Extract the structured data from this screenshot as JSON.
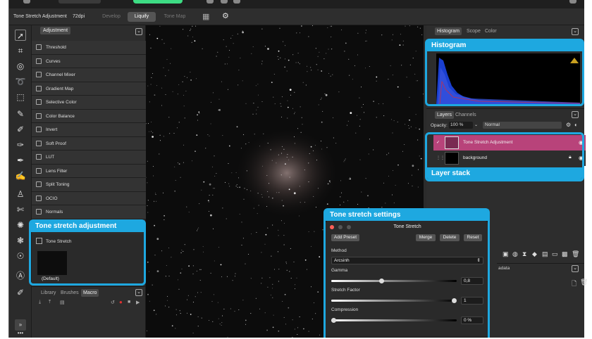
{
  "context": {
    "doc_title": "Tone Stretch Adjustment",
    "dpi": "72dpi",
    "personas": [
      "Develop",
      "Liquify",
      "Tone Map"
    ],
    "active_persona": "Liquify"
  },
  "left_panel": {
    "tab": "Adjustment",
    "items": [
      {
        "label": "Threshold"
      },
      {
        "label": "Curves"
      },
      {
        "label": "Channel Mixer"
      },
      {
        "label": "Gradient Map"
      },
      {
        "label": "Selective Color"
      },
      {
        "label": "Color Balance"
      },
      {
        "label": "Invert"
      },
      {
        "label": "Soft Proof"
      },
      {
        "label": "LUT"
      },
      {
        "label": "Lens Filter"
      },
      {
        "label": "Split Toning"
      },
      {
        "label": "OCIO"
      },
      {
        "label": "Normals"
      }
    ],
    "tone_stretch": {
      "label": "Tone Stretch",
      "preset": "(Default)"
    },
    "bottom_tabs": [
      "Library",
      "Brushes",
      "Macro"
    ],
    "active_bottom_tab": "Macro"
  },
  "right_panel": {
    "top_tabs": [
      "Histogram",
      "Scope",
      "Color"
    ],
    "layer_tabs": [
      "Layers",
      "Channels"
    ],
    "opacity_label": "Opacity:",
    "opacity_value": "100 %",
    "blend_mode": "Normal",
    "layers": [
      {
        "name": "Tone Stretch Adjustment"
      },
      {
        "name": "background"
      }
    ],
    "metadata_partial": "adata"
  },
  "dialog": {
    "title": "Tone Stretch",
    "buttons": {
      "add": "Add Preset",
      "merge": "Merge",
      "delete": "Delete",
      "reset": "Reset"
    },
    "method_label": "Method",
    "method_value": "Arcsinh",
    "gamma_label": "Gamma",
    "gamma_value": "0,8",
    "gamma_level": 0.4,
    "stretch_label": "Stretch Factor",
    "stretch_value": "1",
    "stretch_level": 1.0,
    "compression_label": "Compression",
    "compression_value": "0 %",
    "compression_level": 0.0
  },
  "callouts": {
    "histogram": "Histogram",
    "layer_stack": "Layer stack",
    "tone_adjustment": "Tone stretch adjustment",
    "settings": "Tone stretch settings"
  },
  "colors": {
    "accent": "#1ea8e0",
    "layer_selected": "#b8437a",
    "persona_green": "#3ddc84"
  }
}
